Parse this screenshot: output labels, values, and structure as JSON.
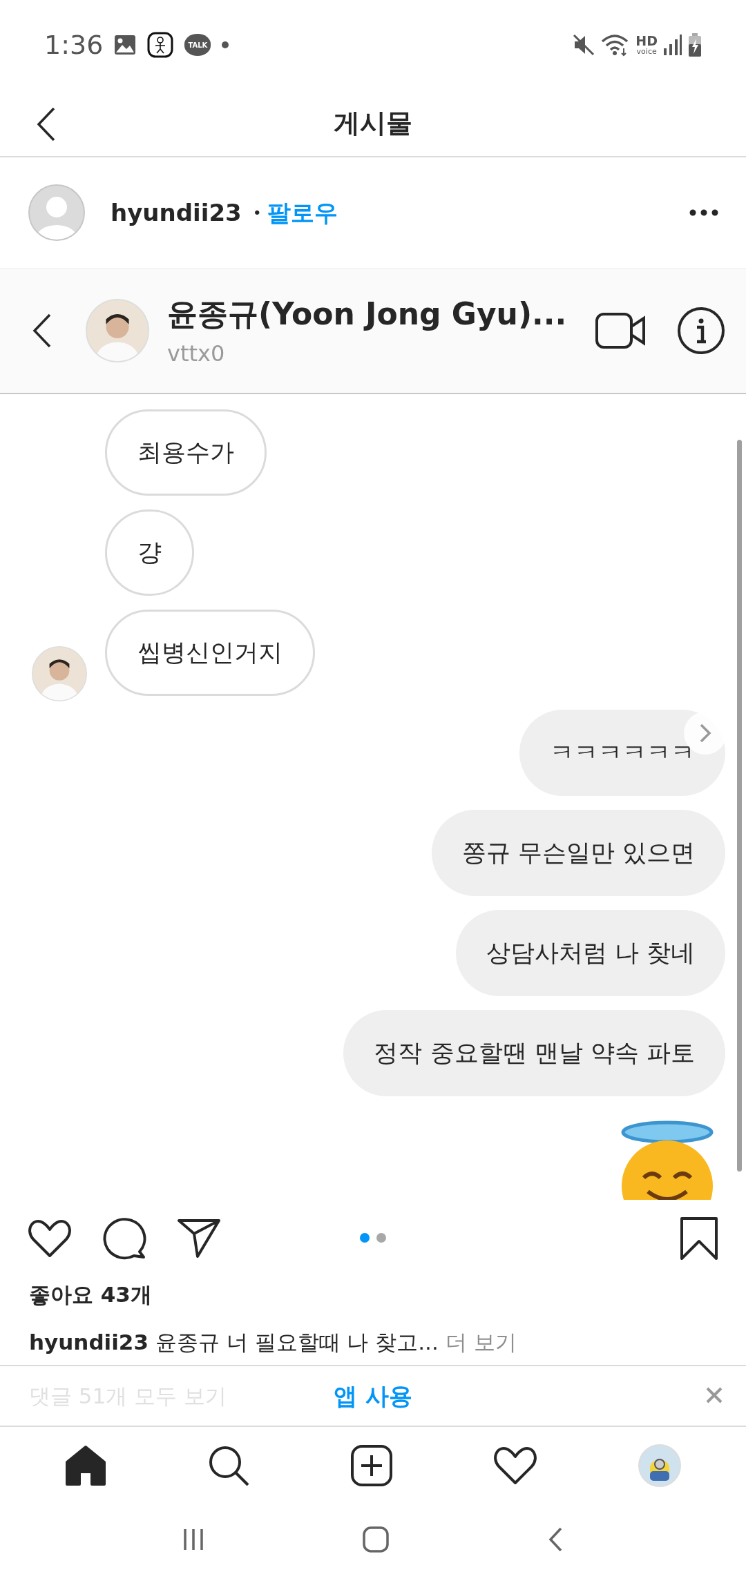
{
  "status_bar": {
    "time": "1:36",
    "talk_label": "TALK",
    "network_label": "HD",
    "network_sublabel": "voice"
  },
  "nav": {
    "title": "게시물"
  },
  "post_header": {
    "username": "hyundii23",
    "separator": "•",
    "follow": "팔로우"
  },
  "chat": {
    "name": "윤종규(Yoon Jong Gyu)...",
    "handle": "vttx0",
    "messages": [
      {
        "kind": "received",
        "text": "최용수가",
        "avatar": false
      },
      {
        "kind": "received",
        "text": "걍",
        "avatar": false
      },
      {
        "kind": "received",
        "text": "씹병신인거지",
        "avatar": true
      },
      {
        "kind": "sent",
        "text": "ㅋㅋㅋㅋㅋㅋ"
      },
      {
        "kind": "sent",
        "text": "쫑규 무슨일만 있으면"
      },
      {
        "kind": "sent",
        "text": "상담사처럼 나 찾네"
      },
      {
        "kind": "sent",
        "text": "정작 중요할땐 맨날 약속 파토"
      },
      {
        "kind": "emoji"
      }
    ]
  },
  "carousel_dots": [
    {
      "selected": true
    },
    {
      "selected": false
    }
  ],
  "likes": "좋아요 43개",
  "caption": {
    "username": "hyundii23",
    "text": "윤종규 너 필요할때 나 찾고...",
    "more": "더 보기"
  },
  "comments_link": "댓글 51개 모두 보기",
  "app_banner": {
    "label": "앱 사용"
  },
  "bottom_nav": [
    {
      "kind": "home",
      "selected": true
    },
    {
      "kind": "search",
      "selected": false
    },
    {
      "kind": "add",
      "selected": false
    },
    {
      "kind": "activity",
      "selected": false
    },
    {
      "kind": "profile",
      "selected": false
    }
  ]
}
